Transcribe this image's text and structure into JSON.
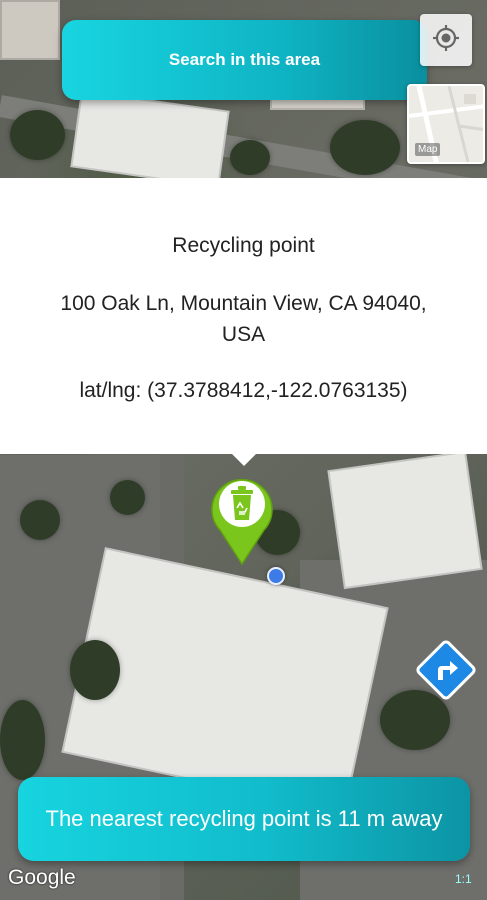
{
  "search": {
    "label": "Search in this area"
  },
  "map_type": {
    "label": "Map"
  },
  "info_window": {
    "title": "Recycling point",
    "address_line1": "100 Oak Ln, Mountain View, CA 94040,",
    "address_line2": "USA",
    "coords": "lat/lng: (37.3788412,-122.0763135)"
  },
  "status": {
    "nearest": "The nearest recycling point is 11 m away"
  },
  "attribution": {
    "logo": "Google",
    "scale": "1:1"
  },
  "icons": {
    "location": "my-location-icon",
    "marker": "recycle-marker-icon",
    "directions": "directions-icon"
  },
  "colors": {
    "accent": "#17d4df",
    "accent_dark": "#0c94a4",
    "marker": "#7bc61c",
    "directions": "#1e88e5",
    "user_dot": "#3d7be6"
  }
}
